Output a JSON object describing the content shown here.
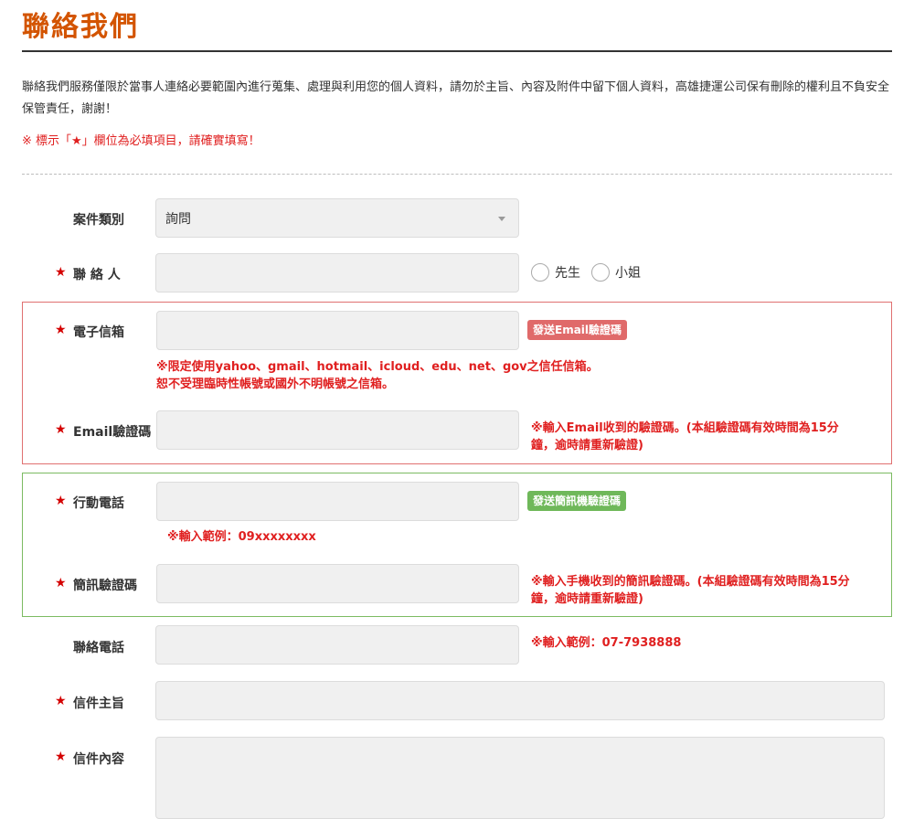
{
  "header": {
    "title": "聯絡我們"
  },
  "intro": {
    "text": "聯絡我們服務僅限於當事人連絡必要範圍內進行蒐集、處理與利用您的個人資料，請勿於主旨、內容及附件中留下個人資料，高雄捷運公司保有刪除的權利且不負安全保管責任，謝謝！",
    "required_note": "※ 標示「★」欄位為必填項目，請確實填寫！"
  },
  "form": {
    "required_mark": "★",
    "case_type": {
      "label": "案件類別",
      "value": "詢問"
    },
    "contact_person": {
      "label": "聯 絡 人",
      "value": "",
      "options": [
        "先生",
        "小姐"
      ]
    },
    "email": {
      "label": "電子信箱",
      "value": "",
      "send_button": "發送Email驗證碼",
      "hint_line1": "※限定使用yahoo、gmail、hotmail、icloud、edu、net、gov之信任信箱。",
      "hint_line2": "恕不受理臨時性帳號或國外不明帳號之信箱。"
    },
    "email_code": {
      "label": "Email驗證碼",
      "value": "",
      "hint_line1": "※輸入Email收到的驗證碼。(本組驗證碼有效時間為15分",
      "hint_line2": "鐘，逾時請重新驗證)"
    },
    "mobile": {
      "label": "行動電話",
      "value": "",
      "send_button": "發送簡訊機驗證碼",
      "hint": "※輸入範例：09xxxxxxxx"
    },
    "sms_code": {
      "label": "簡訊驗證碼",
      "value": "",
      "hint_line1": "※輸入手機收到的簡訊驗證碼。(本組驗證碼有效時間為15分",
      "hint_line2": "鐘，逾時請重新驗證)"
    },
    "phone": {
      "label": "聯絡電話",
      "value": "",
      "hint": "※輸入範例：07-7938888"
    },
    "subject": {
      "label": "信件主旨",
      "value": ""
    },
    "content": {
      "label": "信件內容",
      "value": ""
    }
  },
  "colors": {
    "title": "#d35400",
    "required": "#d40000",
    "hint": "#e02020",
    "email_box_border": "#e07070",
    "mobile_box_border": "#7cbb62",
    "email_button": "#e06a6a",
    "sms_button": "#6fb85a"
  },
  "icons": {
    "select": "chevron-down-icon",
    "radio": "radio-circle-icon"
  }
}
